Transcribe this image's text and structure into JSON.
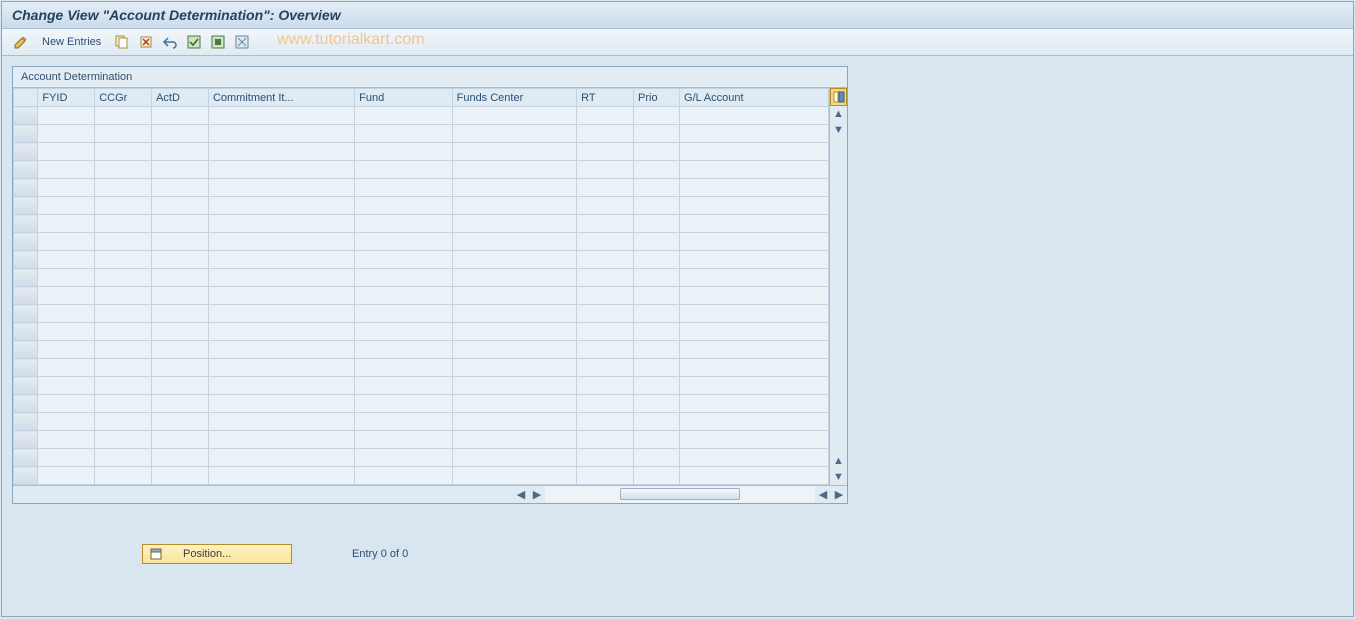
{
  "title": "Change View \"Account Determination\": Overview",
  "toolbar": {
    "new_entries": "New Entries"
  },
  "watermark": "www.tutorialkart.com",
  "table": {
    "title": "Account Determination",
    "columns": [
      "FYID",
      "CCGr",
      "ActD",
      "Commitment It...",
      "Fund",
      "Funds Center",
      "RT",
      "Prio",
      "G/L Account"
    ],
    "row_count": 21
  },
  "footer": {
    "position_label": "Position...",
    "entry_text": "Entry 0 of 0"
  }
}
